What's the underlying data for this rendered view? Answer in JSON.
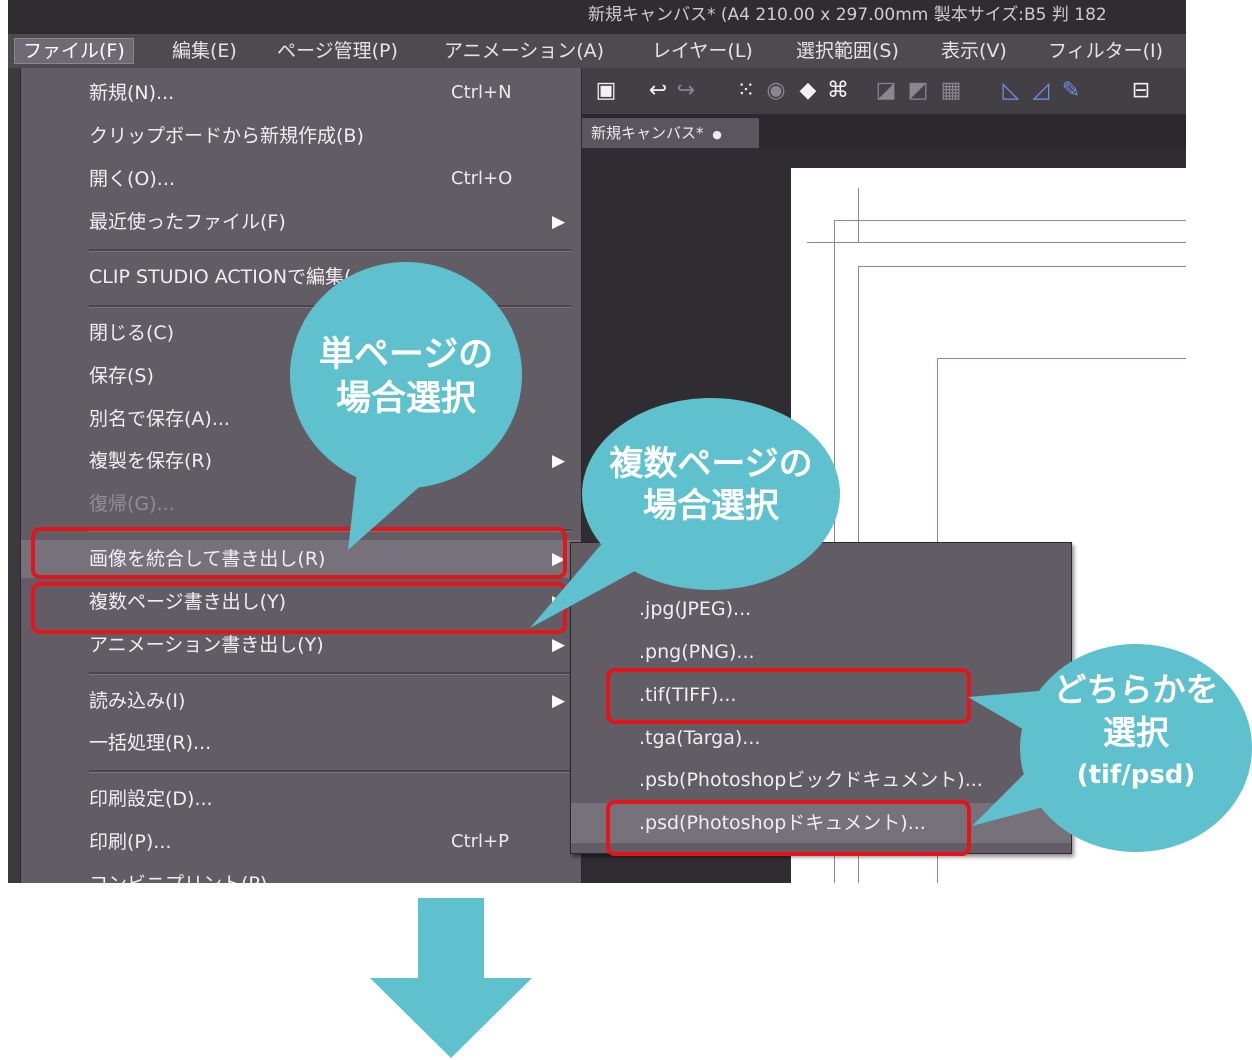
{
  "window": {
    "title": "新規キャンバス* (A4 210.00 x 297.00mm 製本サイズ:B5 判 182"
  },
  "menubar": [
    {
      "label": "ファイル(F)",
      "active": true
    },
    {
      "label": "編集(E)"
    },
    {
      "label": "ページ管理(P)"
    },
    {
      "label": "アニメーション(A)"
    },
    {
      "label": "レイヤー(L)"
    },
    {
      "label": "選択範囲(S)"
    },
    {
      "label": "表示(V)"
    },
    {
      "label": "フィルター(I)"
    }
  ],
  "document_tab": {
    "label": "新規キャンバス*",
    "modified_marker": "●"
  },
  "file_menu": {
    "items": [
      {
        "label": "新規(N)...",
        "shortcut": "Ctrl+N"
      },
      {
        "label": "クリップボードから新規作成(B)"
      },
      {
        "label": "開く(O)...",
        "shortcut": "Ctrl+O"
      },
      {
        "label": "最近使ったファイル(F)",
        "submenu": true
      },
      {
        "label": "CLIP STUDIO ACTIONで編集(",
        "partially_hidden": true
      },
      {
        "label": "閉じる(C)"
      },
      {
        "label": "保存(S)"
      },
      {
        "label": "別名で保存(A)..."
      },
      {
        "label": "複製を保存(R)",
        "submenu": true
      },
      {
        "label": "復帰(G)...",
        "disabled": true
      },
      {
        "label": "画像を統合して書き出し(R)",
        "submenu": true,
        "highlighted": true
      },
      {
        "label": "複数ページ書き出し(Y)",
        "submenu": true
      },
      {
        "label": "アニメーション書き出し(Y)",
        "submenu": true
      },
      {
        "label": "読み込み(I)",
        "submenu": true
      },
      {
        "label": "一括処理(R)..."
      },
      {
        "label": "印刷設定(D)..."
      },
      {
        "label": "印刷(P)...",
        "shortcut": "Ctrl+P"
      },
      {
        "label": "コンビニプリント(P)",
        "partially_hidden": true
      }
    ],
    "submenu_arrow": "▶"
  },
  "export_submenu": {
    "items": [
      {
        "label": ".jpg(JPEG)..."
      },
      {
        "label": ".png(PNG)..."
      },
      {
        "label": ".tif(TIFF)...",
        "circled": true
      },
      {
        "label": ".tga(Targa)..."
      },
      {
        "label": ".psb(Photoshopビックドキュメント)..."
      },
      {
        "label": ".psd(Photoshopドキュメント)...",
        "highlighted": true,
        "circled": true
      }
    ]
  },
  "callouts": {
    "single_page": {
      "line1": "単ページの",
      "line2": "場合選択"
    },
    "multi_page": {
      "line1": "複数ページの",
      "line2": "場合選択"
    },
    "format": {
      "line1": "どちらかを",
      "line2": "選択",
      "line3": "(tif/psd)"
    }
  },
  "toolbar_icons": [
    "save-icon",
    "undo-icon",
    "redo-icon",
    "selection-dots-icon",
    "layer-move-icon",
    "fill-icon",
    "transform-icon",
    "ruler-icon",
    "perspective-icon",
    "grid-icon",
    "frame-icon",
    "pen-icon",
    "marker-icon"
  ],
  "colors": {
    "callout": "#5fc0ce",
    "highlight_border": "#e3151b",
    "menu_bg": "#625d64",
    "arrow": "#5fc0ce"
  }
}
